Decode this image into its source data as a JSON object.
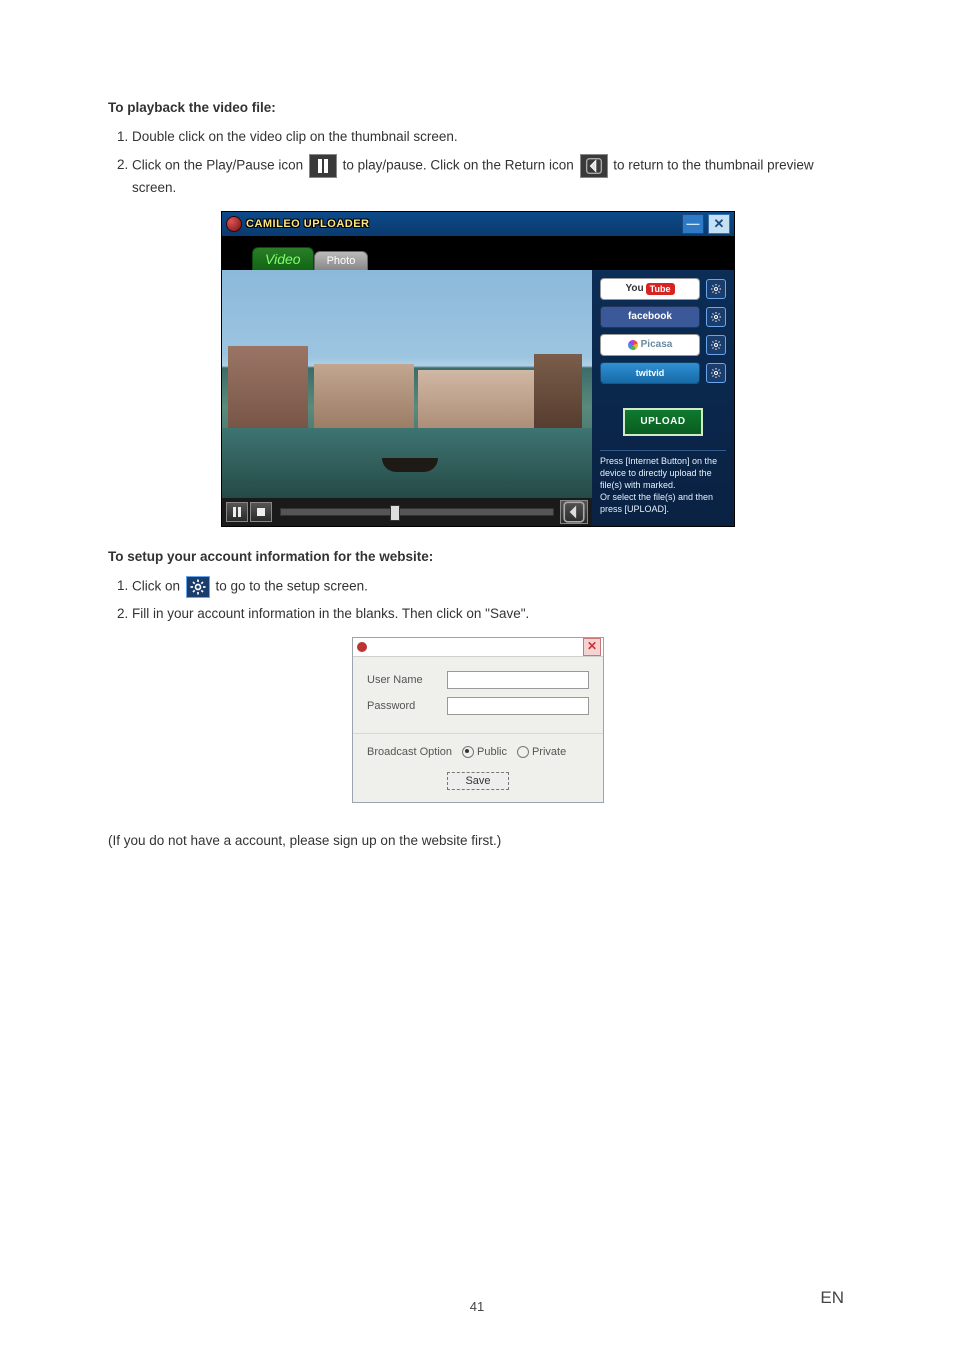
{
  "section_playback_title": "To playback the video file:",
  "playback": {
    "step1": "Double click on the video clip on the thumbnail screen.",
    "step2_a": "Click on the Play/Pause icon ",
    "step2_b": " to play/pause. Click on the Return icon ",
    "step2_c": " to return to the thumbnail preview screen."
  },
  "uploader": {
    "app_title": "CAMILEO UPLOADER",
    "tabs": {
      "video": "Video",
      "photo": "Photo"
    },
    "services": {
      "youtube_you": "You",
      "youtube_tube": "Tube",
      "facebook": "facebook",
      "picasa": "Picasa",
      "twitvid": "twitvid"
    },
    "upload_label": "UPLOAD",
    "hint_line1": "Press [Internet Button] on the device to directly upload the file(s) with marked.",
    "hint_line2": "Or select the file(s) and then press [UPLOAD]."
  },
  "section_account_title": "To setup your account information for the website:",
  "account": {
    "step1_a": "Click on ",
    "step1_b": " to go to the setup screen.",
    "step2": "Fill in your account information in the blanks. Then click on \"Save\"."
  },
  "dialog": {
    "user_name_label": "User Name",
    "password_label": "Password",
    "broadcast_label": "Broadcast Option",
    "public_label": "Public",
    "private_label": "Private",
    "save_label": "Save"
  },
  "account_note": "(If you do not have a account, please sign up on the website first.)",
  "footer": {
    "page": "41",
    "lang": "EN"
  }
}
